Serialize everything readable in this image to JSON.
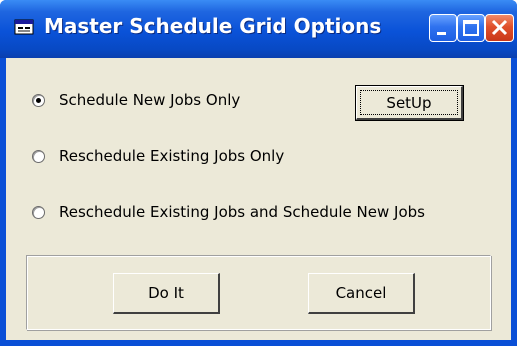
{
  "window": {
    "title": "Master Schedule Grid Options",
    "icons": {
      "app": "app-icon",
      "minimize": "minimize-icon",
      "maximize": "maximize-icon",
      "close": "close-icon"
    }
  },
  "options": [
    {
      "label": "Schedule New Jobs Only",
      "checked": true
    },
    {
      "label": "Reschedule Existing Jobs Only",
      "checked": false
    },
    {
      "label": "Reschedule Existing Jobs and Schedule New Jobs",
      "checked": false
    }
  ],
  "buttons": {
    "setup_label": "SetUp",
    "doit_label": "Do It",
    "cancel_label": "Cancel"
  },
  "colors": {
    "titlebar": "#0a52d8",
    "client": "#ece9d8",
    "close": "#e0502c"
  }
}
